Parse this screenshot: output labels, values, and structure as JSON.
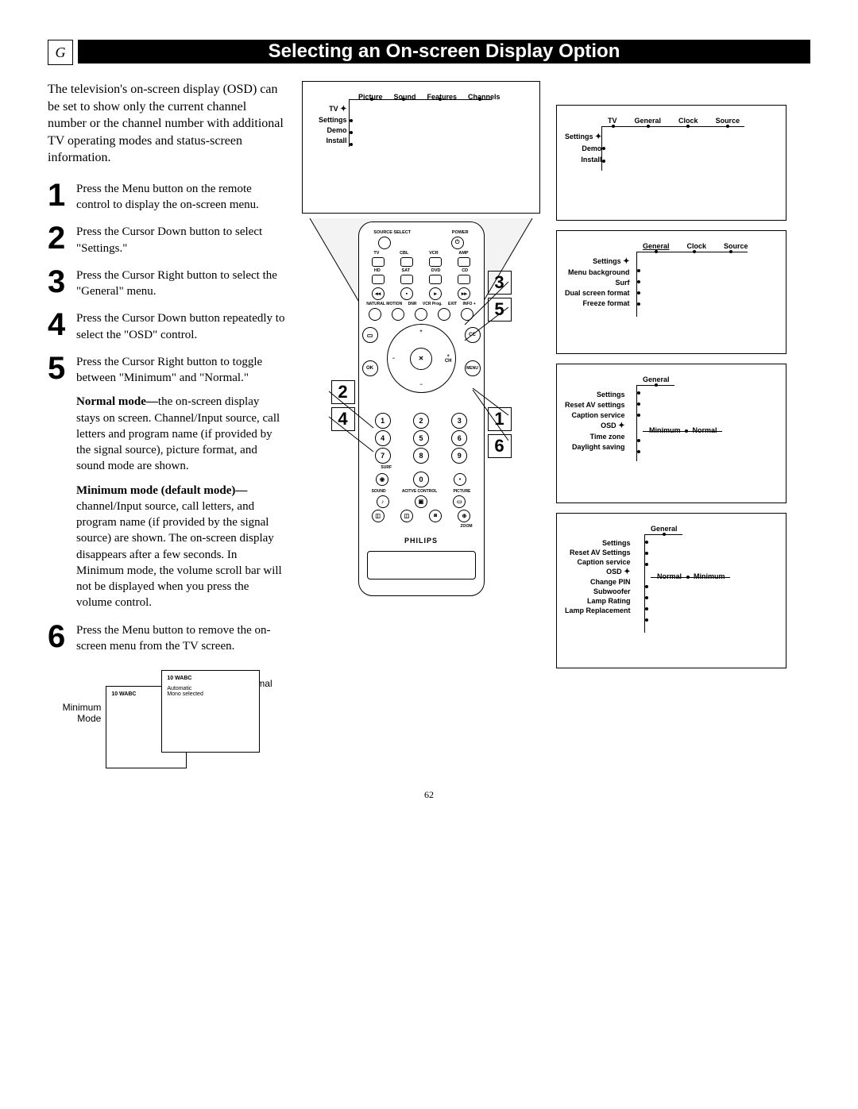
{
  "section_letter": "G",
  "title": "Selecting an On-screen Display Option",
  "intro": "The television's on-screen display (OSD) can be set to show only the current channel number or the channel number with additional TV operating modes and status-screen information.",
  "steps": [
    {
      "n": "1",
      "t": "Press the Menu button on the remote control to display the on-screen menu."
    },
    {
      "n": "2",
      "t": "Press the Cursor Down button to select \"Settings.\""
    },
    {
      "n": "3",
      "t": "Press the Cursor Right button to select the \"General\" menu."
    },
    {
      "n": "4",
      "t": "Press the Cursor Down button repeatedly to select the \"OSD\" control."
    },
    {
      "n": "5",
      "t": "Press the Cursor Right button to toggle between \"Minimum\" and \"Normal.\""
    }
  ],
  "normal_mode_label": "Normal mode—",
  "normal_mode_text": "the on-screen display stays on screen. Channel/Input source, call letters and program name (if provided by the signal source), picture format, and sound mode are shown.",
  "minimum_mode_label": "Minimum mode (default mode)—",
  "minimum_mode_text": "channel/Input source, call letters, and program name (if provided by the signal source) are shown. The on-screen display disappears after a few seconds. In Minimum mode, the volume scroll bar will not be displayed when you press the volume control.",
  "step6": {
    "n": "6",
    "t": "Press the Menu button to remove the on-screen menu from the TV screen."
  },
  "mode_diag": {
    "minimum_label": "Minimum Mode",
    "normal_label": "Normal Mode",
    "ch_small": "10  WABC",
    "ch_full_line1": "10  WABC",
    "ch_full_line2": "Automatic",
    "ch_full_line3": "Mono selected"
  },
  "top_menu": {
    "cols": [
      "Picture",
      "Sound",
      "Features",
      "Channels"
    ],
    "rows": [
      "TV",
      "Settings",
      "Demo",
      "Install"
    ],
    "selected": "TV"
  },
  "remote": {
    "top_labels_row1": [
      "SOURCE SELECT",
      "POWER"
    ],
    "device_row1": [
      "TV",
      "CBL",
      "VCR",
      "AMP"
    ],
    "device_row2": [
      "HD",
      "SAT",
      "DVD",
      "CD"
    ],
    "mid_labels": [
      "NATURAL MOTION",
      "DNR",
      "VCR Prog.",
      "EXIT",
      "INFO +"
    ],
    "side_ok": "OK",
    "side_menu": "MENU",
    "cc": "CC",
    "ch": "CH",
    "surf": "SURF",
    "bottom_labels": [
      "SOUND",
      "ACITVE CONTROL",
      "PICTURE"
    ],
    "zoom": "ZOOM",
    "brand": "PHILIPS",
    "numbers": [
      "1",
      "2",
      "3",
      "4",
      "5",
      "6",
      "7",
      "8",
      "9",
      "0"
    ]
  },
  "callouts_left": [
    "2",
    "4"
  ],
  "callouts_right": [
    "3",
    "5",
    "1",
    "6"
  ],
  "diag1": {
    "cols": [
      "TV",
      "General",
      "Clock",
      "Source"
    ],
    "rows": [
      "Settings",
      "Demo",
      "Install"
    ],
    "selected_col": "TV",
    "selected_row": "Settings"
  },
  "diag2": {
    "cols": [
      "General",
      "Clock",
      "Source"
    ],
    "rows": [
      "Settings",
      "Menu background",
      "Surf",
      "Dual screen format",
      "Freeze format"
    ],
    "selected_col": "General"
  },
  "diag3": {
    "cols": [
      "General"
    ],
    "rows": [
      "Settings",
      "Reset AV settings",
      "Caption service",
      "OSD",
      "Time zone",
      "Daylight saving"
    ],
    "selected_row": "OSD",
    "options": [
      "Minimum",
      "Normal"
    ],
    "sel_opt": "Minimum"
  },
  "diag4": {
    "cols": [
      "General"
    ],
    "rows": [
      "Settings",
      "Reset AV Settings",
      "Caption service",
      "OSD",
      "Change PIN",
      "Subwoofer",
      "Lamp Rating",
      "Lamp Replacement"
    ],
    "selected_row": "OSD",
    "options": [
      "Normal",
      "Minimum"
    ],
    "sel_opt": "Normal"
  },
  "page_number": "62"
}
